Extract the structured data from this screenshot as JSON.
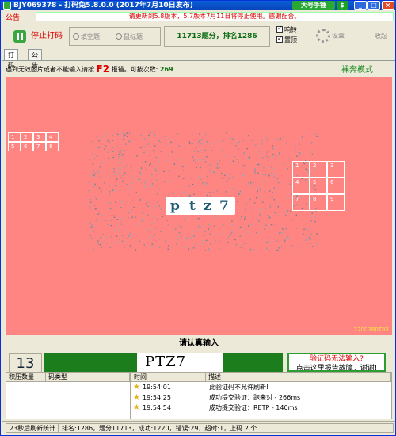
{
  "window": {
    "title": "BJY069378 - 打码兔5.8.0.0 (2017年7月10日发布)",
    "ad_label": "大号手锤",
    "ad_badge": "$"
  },
  "notice": {
    "label": "公告:",
    "text": "请更新到5.8版本，5.7版本7月11日将停止使用。感谢配合。"
  },
  "toolbar": {
    "stop_label": "停止打码",
    "radio_fill": "填空题",
    "radio_click": "鼠标题",
    "score_text": "11713题分，排名1286",
    "check_bell": "响铃",
    "check_top": "置顶",
    "settings_label": "设置",
    "collapse_label": "收起"
  },
  "tabs": [
    "打码",
    "公告"
  ],
  "hint": {
    "prefix": "遇到无效图片或者不能输入请按",
    "key": "F2",
    "middle": "报错。可按次数:",
    "count": "269"
  },
  "mode_label": "裸奔模式",
  "canvas": {
    "captcha_chars": [
      "p",
      "t",
      "z",
      "7"
    ],
    "grid_left": [
      "1",
      "2",
      "3",
      "4",
      "5",
      "6",
      "7",
      "8"
    ],
    "grid_right": [
      "1",
      "2",
      "3",
      "4",
      "5",
      "6",
      "7",
      "8",
      "9"
    ],
    "image_id": "1200380T83"
  },
  "please_input": "请认真输入",
  "answer": {
    "countdown": "13",
    "value": "PTZ7",
    "cant_input": "验证码无法输入?",
    "cant_input_sub": "点击这里报告故障，谢谢!"
  },
  "left_table": {
    "headers": [
      "积压数量",
      "码类型"
    ]
  },
  "right_table": {
    "headers": [
      "时间",
      "描述"
    ],
    "rows": [
      {
        "time": "19:54:01",
        "desc": "此验证码不允许刷新!"
      },
      {
        "time": "19:54:25",
        "desc": "成功提交验证：跑来对 - 266ms"
      },
      {
        "time": "19:54:54",
        "desc": "成功提交验证：RETP - 140ms"
      }
    ]
  },
  "status": {
    "refresh": "23秒后刷新统计",
    "stats": "排名:1286，题分11713，成功:1220，错误:29，超时:1，上码 2 个"
  },
  "colors": {
    "canvas_bg": "#ff8583",
    "accent_green": "#1b7d1b",
    "warn_red": "#dd0000"
  }
}
